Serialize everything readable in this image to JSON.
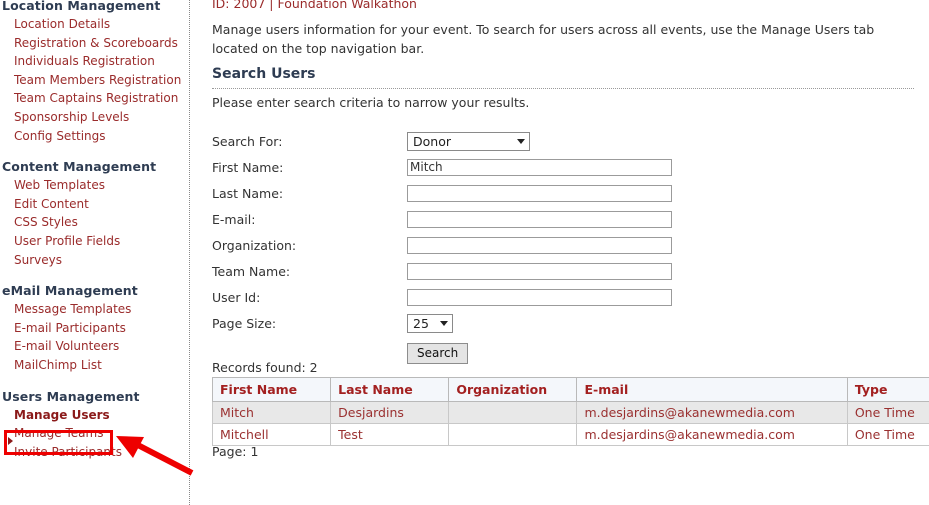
{
  "sidebar": {
    "groups": [
      {
        "heading": "Location Management",
        "items": [
          "Location Details",
          "Registration & Scoreboards",
          "Individuals Registration",
          "Team Members Registration",
          "Team Captains Registration",
          "Sponsorship Levels",
          "Config Settings"
        ]
      },
      {
        "heading": "Content Management",
        "items": [
          "Web Templates",
          "Edit Content",
          "CSS Styles",
          "User Profile Fields",
          "Surveys"
        ]
      },
      {
        "heading": "eMail Management",
        "items": [
          "Message Templates",
          "E-mail Participants",
          "E-mail Volunteers",
          "MailChimp List"
        ]
      },
      {
        "heading": "Users Management",
        "items": [
          "Manage Users",
          "Manage Teams",
          "Invite Participants"
        ]
      }
    ],
    "active_item": "Manage Users"
  },
  "annotation": {
    "highlight_color": "#ee0000",
    "arrow_color": "#ee0000"
  },
  "main": {
    "breadcrumb": "ID: 2007 | Foundation Walkathon",
    "intro": "Manage users information for your event. To search for users across all events, use the Manage Users tab located on the top navigation bar.",
    "section_title": "Search Users",
    "section_subtext": "Please enter search criteria to narrow your results.",
    "form": {
      "search_for_label": "Search For:",
      "search_for_value": "Donor",
      "first_name_label": "First Name:",
      "first_name_value": "Mitch",
      "last_name_label": "Last Name:",
      "last_name_value": "",
      "email_label": "E-mail:",
      "email_value": "",
      "organization_label": "Organization:",
      "organization_value": "",
      "team_name_label": "Team Name:",
      "team_name_value": "",
      "user_id_label": "User Id:",
      "user_id_value": "",
      "page_size_label": "Page Size:",
      "page_size_value": "25",
      "search_button": "Search"
    },
    "results": {
      "records_found": "Records found: 2",
      "columns": [
        "First Name",
        "Last Name",
        "Organization",
        "E-mail",
        "Type"
      ],
      "rows": [
        [
          "Mitch",
          "Desjardins",
          "",
          "m.desjardins@akanewmedia.com",
          "One Time"
        ],
        [
          "Mitchell",
          "Test",
          "",
          "m.desjardins@akanewmedia.com",
          "One Time"
        ]
      ],
      "page_label": "Page: 1"
    }
  }
}
